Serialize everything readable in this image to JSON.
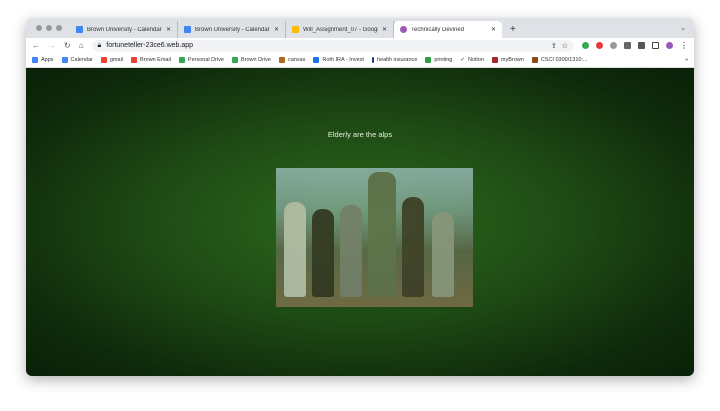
{
  "browser": {
    "tabs": [
      {
        "title": "Brown University - Calendar -",
        "icon": "calendar-icon",
        "color": "#4285f4"
      },
      {
        "title": "Brown University - Calendar -",
        "icon": "calendar-icon",
        "color": "#4285f4"
      },
      {
        "title": "Will_Assignment_07 - Google",
        "icon": "drive-icon",
        "color": "#fbbc04"
      },
      {
        "title": "Technically Devined",
        "icon": "site-icon",
        "color": "#9b59b6",
        "active": true
      }
    ],
    "url": "fortuneteller-23ce6.web.app",
    "bookmarks": [
      {
        "label": "Apps",
        "color": "#4285f4"
      },
      {
        "label": "Calendar",
        "color": "#4285f4"
      },
      {
        "label": "gmail",
        "color": "#ea4335"
      },
      {
        "label": "Brown Email",
        "color": "#ea4335"
      },
      {
        "label": "Personal Drive",
        "color": "#34a853"
      },
      {
        "label": "Brown Drive",
        "color": "#34a853"
      },
      {
        "label": "canvas",
        "color": "#b5651d"
      },
      {
        "label": "Roth IRA - Invest",
        "color": "#1a73e8"
      },
      {
        "label": "health insurance",
        "color": "#1a3a8a"
      },
      {
        "label": "printing",
        "color": "#2e9e3e"
      },
      {
        "label": "Notion",
        "color": "#222222"
      },
      {
        "label": "myBrown",
        "color": "#a0282c"
      },
      {
        "label": "CSCI 0300/1310:...",
        "color": "#8a4b1a"
      }
    ]
  },
  "page": {
    "fortune": "Elderly are the alps"
  }
}
